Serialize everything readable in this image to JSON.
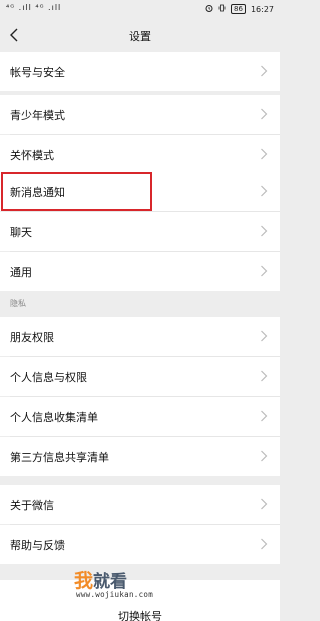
{
  "status_bar": {
    "left_indicators": "⁴ᴳ .ıll ⁴ᴳ .ıll",
    "icons": [
      "alarm-icon",
      "vibrate-icon"
    ],
    "battery": "86",
    "time": "16:27"
  },
  "header": {
    "title": "设置",
    "back_icon": "chevron-left-icon"
  },
  "settings_items": [
    {
      "label": "帐号与安全"
    },
    {
      "label": "青少年模式"
    },
    {
      "label": "关怀模式"
    },
    {
      "label": "新消息通知"
    },
    {
      "label": "聊天"
    },
    {
      "label": "通用"
    },
    {
      "label": "朋友权限"
    },
    {
      "label": "个人信息与权限"
    },
    {
      "label": "个人信息收集清单"
    },
    {
      "label": "第三方信息共享清单"
    },
    {
      "label": "关于微信"
    },
    {
      "label": "帮助与反馈"
    }
  ],
  "section_header": "隐私",
  "partial_item": "切换帐号",
  "highlight_color": "#d8262b",
  "watermark": {
    "first_char": "我",
    "rest": "就看",
    "url": "www.wojiukan.com"
  }
}
